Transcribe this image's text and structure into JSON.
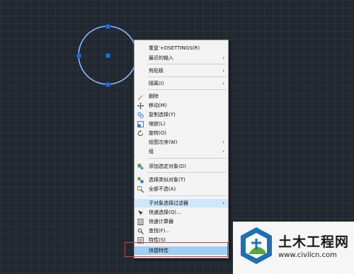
{
  "menu": {
    "items": [
      {
        "label": "重复'+DSETTINGS(R)",
        "submenu": false,
        "icon": ""
      },
      {
        "label": "最近的输入",
        "submenu": true,
        "icon": ""
      },
      {
        "label": "剪贴板",
        "submenu": true,
        "icon": ""
      },
      {
        "label": "隔离(I)",
        "submenu": true,
        "icon": ""
      },
      {
        "label": "删除",
        "submenu": false,
        "icon": "eraser-icon"
      },
      {
        "label": "移动(M)",
        "submenu": false,
        "icon": "move-icon"
      },
      {
        "label": "复制选择(Y)",
        "submenu": false,
        "icon": "copy-icon"
      },
      {
        "label": "缩放(L)",
        "submenu": false,
        "icon": "scale-icon"
      },
      {
        "label": "旋转(O)",
        "submenu": false,
        "icon": "rotate-icon"
      },
      {
        "label": "绘图次序(W)",
        "submenu": true,
        "icon": ""
      },
      {
        "label": "组",
        "submenu": true,
        "icon": ""
      },
      {
        "label": "添加选定对象(D)",
        "submenu": false,
        "icon": "add-selected-icon"
      },
      {
        "label": "选择类似对象(T)",
        "submenu": false,
        "icon": "select-similar-icon"
      },
      {
        "label": "全部不选(A)",
        "submenu": false,
        "icon": "deselect-all-icon"
      },
      {
        "label": "子对象选择过滤器",
        "submenu": true,
        "icon": ""
      },
      {
        "label": "快速选择(Q)...",
        "submenu": false,
        "icon": "quick-select-icon"
      },
      {
        "label": "快速计算器",
        "submenu": false,
        "icon": "calculator-icon"
      },
      {
        "label": "查找(F)...",
        "submenu": false,
        "icon": "find-icon"
      },
      {
        "label": "特性(S)",
        "submenu": false,
        "icon": "properties-icon"
      },
      {
        "label": "快捷特性",
        "submenu": false,
        "icon": ""
      }
    ],
    "submenu_arrow": "›"
  },
  "watermark": {
    "title": "土木工程网",
    "url": "www.civilcn.com"
  },
  "colors": {
    "canvas_bg": "#212830",
    "selection_circle": "#8fb7ff",
    "grip": "#1f6fe0",
    "highlight": "#9fcff3",
    "callout_border": "#d9403a",
    "logo_blue": "#1d6fb8",
    "logo_green": "#5aa832"
  }
}
